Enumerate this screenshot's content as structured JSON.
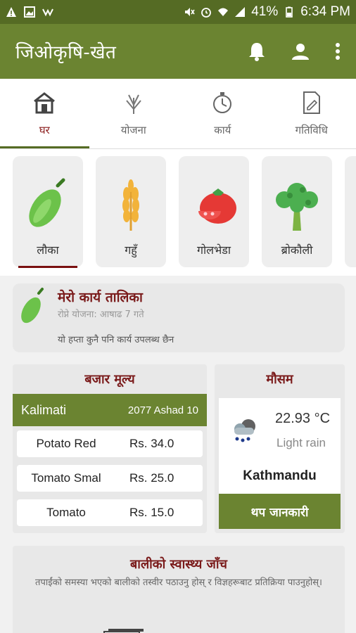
{
  "status_bar": {
    "battery": "41%",
    "time": "6:34 PM",
    "icons": [
      "alert-icon",
      "image-icon",
      "app-icon",
      "mute-icon",
      "alarm-icon",
      "wifi-icon",
      "signal-icon",
      "battery-icon"
    ]
  },
  "app_bar": {
    "title": "जिओकृषि-खेत",
    "icons": [
      "bell-icon",
      "profile-icon",
      "more-vertical-icon"
    ],
    "accent": "#6b8431"
  },
  "tabs": [
    {
      "label": "घर",
      "icon": "house-icon",
      "active": true
    },
    {
      "label": "योजना",
      "icon": "wheat-icon",
      "active": false
    },
    {
      "label": "कार्य",
      "icon": "stopwatch-icon",
      "active": false
    },
    {
      "label": "गतिविधि",
      "icon": "document-icon",
      "active": false
    }
  ],
  "crops": [
    {
      "name": "लौका",
      "icon": "gourd-icon",
      "selected": true
    },
    {
      "name": "गहुँ",
      "icon": "wheat-icon"
    },
    {
      "name": "गोलभेडा",
      "icon": "tomato-icon"
    },
    {
      "name": "ब्रोकौली",
      "icon": "broccoli-icon"
    }
  ],
  "task": {
    "title": "मेरो कार्य तालिका",
    "subtitle": "रोप्ने योजना: आषाढ 7 गते",
    "message": "यो हप्ता कुनै पनि कार्य उपलब्ध छैन"
  },
  "market": {
    "heading": "बजार मूल्य",
    "market_name": "Kalimati",
    "date": "2077 Ashad 10",
    "rows": [
      {
        "item": "Potato Red",
        "price": "Rs. 34.0"
      },
      {
        "item": "Tomato Smal",
        "price": "Rs. 25.0"
      },
      {
        "item": "Tomato",
        "price": "Rs. 15.0"
      }
    ]
  },
  "weather": {
    "heading": "मौसम",
    "temperature": "22.93",
    "unit": "°C",
    "condition": "Light rain",
    "city": "Kathmandu",
    "more_button": "थप जानकारी"
  },
  "health": {
    "heading": "बालीको स्वास्थ्य जाँच",
    "description": "तपाईंको समस्या भएको बालीको तस्वीर पठाउनु होस् र विज्ञहरूबाट प्रतिक्रिया पाउनुहोस्।"
  }
}
